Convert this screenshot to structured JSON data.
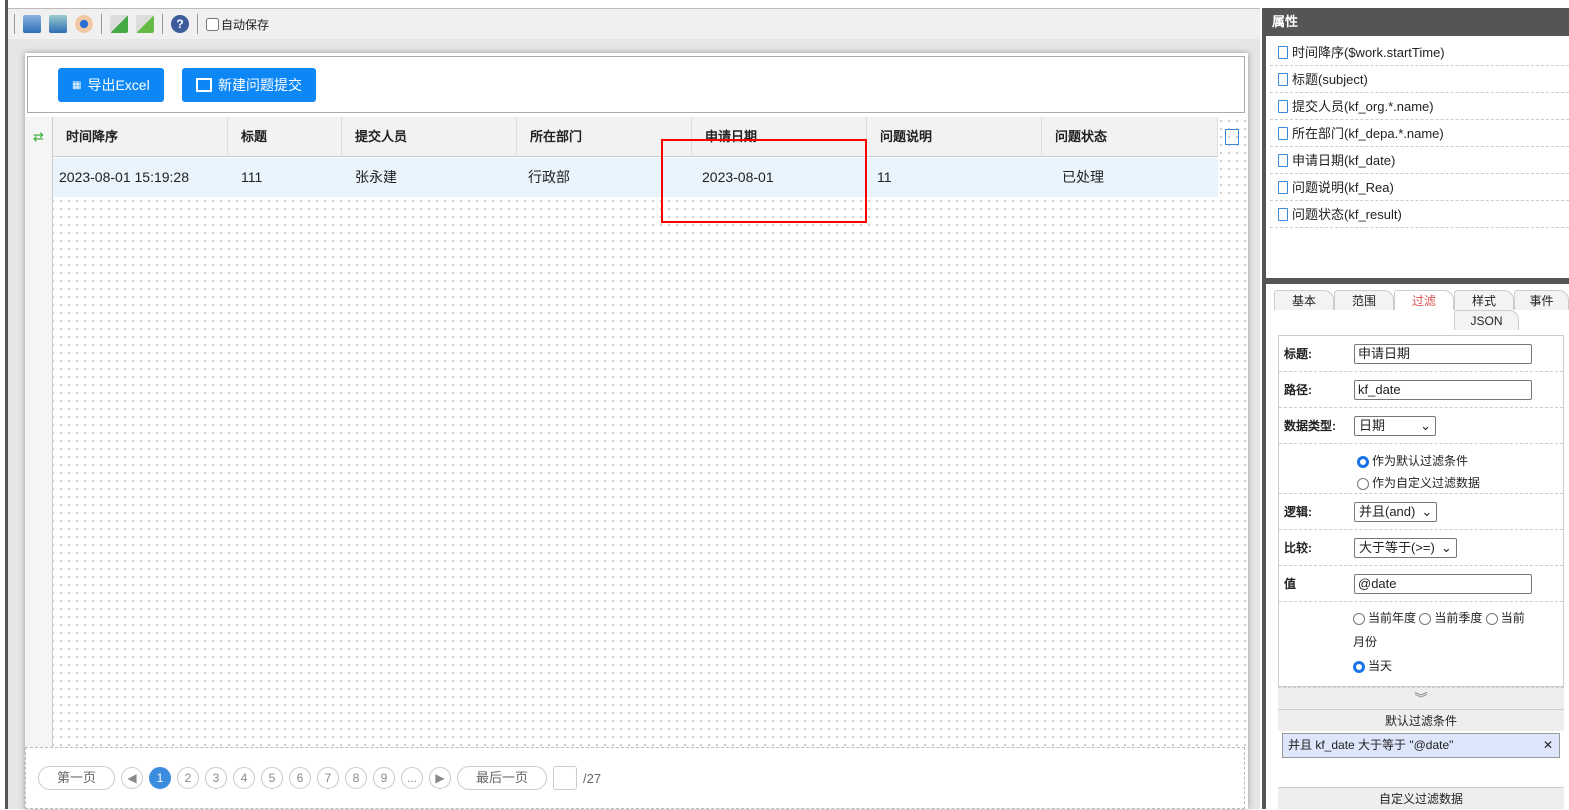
{
  "toolbar": {
    "icons": [
      "save-icon",
      "save-as-icon",
      "preview-icon",
      "export-icon",
      "import-icon",
      "help-icon"
    ],
    "autosave_label": "自动保存"
  },
  "buttons": {
    "export": "导出Excel",
    "new": "新建问题提交"
  },
  "grid": {
    "columns": [
      "时间降序",
      "标题",
      "提交人员",
      "所在部门",
      "申请日期",
      "问题说明",
      "问题状态"
    ],
    "rows": [
      [
        "2023-08-01 15:19:28",
        "111",
        "张永建",
        "行政部",
        "2023-08-01",
        "11",
        "已处理"
      ]
    ]
  },
  "pager": {
    "first": "第一页",
    "pages": [
      "1",
      "2",
      "3",
      "4",
      "5",
      "6",
      "7",
      "8",
      "9",
      "..."
    ],
    "current": "1",
    "last": "最后一页",
    "total": "/27"
  },
  "properties": {
    "title": "属性",
    "items": [
      "时间降序($work.startTime)",
      "标题(subject)",
      "提交人员(kf_org.*.name)",
      "所在部门(kf_depa.*.name)",
      "申请日期(kf_date)",
      "问题说明(kf_Rea)",
      "问题状态(kf_result)"
    ]
  },
  "tabs": [
    "基本",
    "范围",
    "过滤",
    "样式",
    "事件",
    "JSON"
  ],
  "form": {
    "title_label": "标题:",
    "title_value": "申请日期",
    "path_label": "路径:",
    "path_value": "kf_date",
    "type_label": "数据类型:",
    "type_value": "日期",
    "radio_default": "作为默认过滤条件",
    "radio_custom": "作为自定义过滤数据",
    "logic_label": "逻辑:",
    "logic_value": "并且(and)",
    "compare_label": "比较:",
    "compare_value": "大于等于(>=)",
    "value_label": "值",
    "value_value": "@date",
    "opt_year": "当前年度",
    "opt_quarter": "当前季度",
    "opt_month_a": "当前",
    "opt_month_b": "月份",
    "opt_today": "当天"
  },
  "default_section": "默认过滤条件",
  "default_item": "并且 kf_date 大于等于 \"@date\"",
  "custom_section": "自定义过滤数据",
  "colors": {
    "accent": "#0d87f5",
    "highlight": "#ff0000",
    "active_tab": "#d9534f"
  }
}
